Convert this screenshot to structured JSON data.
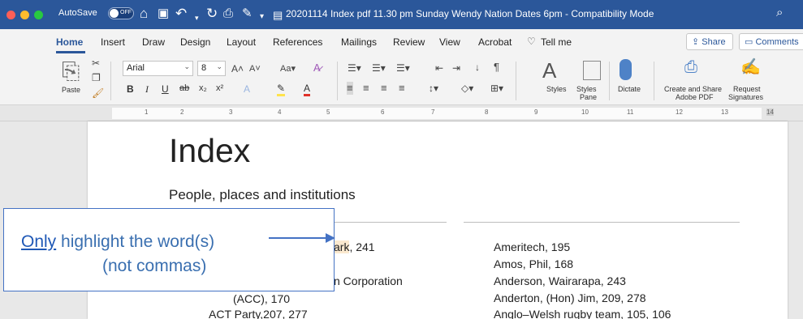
{
  "window": {
    "autosave_label": "AutoSave",
    "autosave_state": "OFF",
    "document_title": "20201114 Index pdf 11.30 pm Sunday Wendy Nation Dates 6pm  -  Compatibility Mode"
  },
  "ribbon": {
    "tabs": [
      "Home",
      "Insert",
      "Draw",
      "Design",
      "Layout",
      "References",
      "Mailings",
      "Review",
      "View",
      "Acrobat",
      "Tell me"
    ],
    "share_label": "Share",
    "comments_label": "Comments",
    "paste_label": "Paste",
    "font_name": "Arial",
    "font_size": "8",
    "styles_label": "Styles",
    "styles_pane_label": [
      "Styles",
      "Pane"
    ],
    "dictate_label": "Dictate",
    "create_share_label": [
      "Create and Share",
      "Adobe PDF"
    ],
    "request_sig_label": [
      "Request",
      "Signatures"
    ]
  },
  "ruler": {
    "numbers": [
      "1",
      "2",
      "3",
      "4",
      "5",
      "6",
      "7",
      "8",
      "9",
      "10",
      "11",
      "12",
      "13",
      "14"
    ]
  },
  "document": {
    "heading": "Index",
    "subheading": "People, places and institutions",
    "left_column": {
      "entry1_highlighted": "ark",
      "entry1_rest": ", 241",
      "entry2_fragment": "n Corporation",
      "entry3": "(ACC), 170",
      "entry4": "ACT Party,207, 277"
    },
    "right_column": [
      "Ameritech, 195",
      "Amos, Phil, 168",
      "Anderson, Wairarapa, 243",
      "Anderton, (Hon) Jim, 209, 278",
      "Anglo–Welsh rugby team, 105, 106"
    ]
  },
  "callout": {
    "emphasis": "Only",
    "line1_rest": " highlight the word(s)",
    "line2": "(not commas)"
  },
  "colors": {
    "ribbon_blue": "#2b579a",
    "callout_blue": "#4472c4",
    "highlight": "#fbe9cf"
  }
}
